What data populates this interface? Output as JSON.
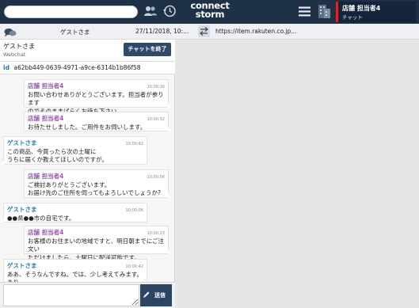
{
  "header": {
    "search": {
      "value": "",
      "placeholder": ""
    },
    "logo": {
      "line1": "connect",
      "line2": "storm"
    },
    "user": {
      "name": "店舗 担当者4",
      "status": "チャット",
      "accent": "#d0262f"
    }
  },
  "info": {
    "guest_name": "ゲストさま",
    "date": "27/11/2018, 10:...",
    "url": "https://item.rakuten.co.jp..."
  },
  "panel": {
    "customer_name": "ゲストさま",
    "source": "Webchat",
    "end_button": "チャットを終了",
    "id_label": "id",
    "id_value": "a62bb449-0639-4971-a9ce-6314b1b86f58"
  },
  "messages": [
    {
      "role": "staff",
      "sender": "店舗 担当者4",
      "time": "10:00:16",
      "text": "お問い合わせありがとうございます。担当者が参ります\nのでそのままばらくお待ち下さい。"
    },
    {
      "role": "staff",
      "sender": "店舗 担当者4",
      "time": "10:00:32",
      "text": "お待たせしました。ご用件をお伺いします。"
    },
    {
      "role": "guest",
      "sender": "ゲストさま",
      "time": "10:00:42",
      "text": "この商品、今買ったら次の土曜に\nうちに届くか教えてほしいのですが。"
    },
    {
      "role": "staff",
      "sender": "店舗 担当者4",
      "time": "10:00:56",
      "text": "ご検討ありがとうございます。\nお届け先のご住所を伺ってもよろしいでしょうか?"
    },
    {
      "role": "guest",
      "sender": "ゲストさま",
      "time": "10:00:06",
      "text": "●●県●●市の自宅です。"
    },
    {
      "role": "staff",
      "sender": "店舗 担当者4",
      "time": "10:00:23",
      "text": "お客様のお住まいの地域ですと、明日朝までにご注文い\nただけましたら、土曜日に配送可能です。"
    },
    {
      "role": "guest",
      "sender": "ゲストさま",
      "time": "10:00:42",
      "text": "ああ、そうなんですね。では、少し考えてみます。あり\nがとうございました。"
    }
  ],
  "composer": {
    "value": "",
    "placeholder": "",
    "send_label": "送信"
  },
  "icons": [
    "users-icon",
    "history-icon",
    "menu-icon",
    "building-icon",
    "chat-bubbles-icon",
    "swap-icon",
    "pen-icon"
  ],
  "colors": {
    "topbar": "#1e3147",
    "button": "#2f4a68",
    "staff_name": "#9b59b6",
    "guest_name": "#2a7ab8",
    "id_label": "#1e73be"
  }
}
